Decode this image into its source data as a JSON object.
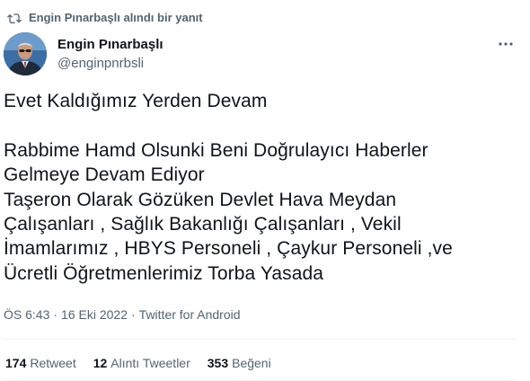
{
  "social_context": {
    "icon": "retweet-icon",
    "text": "Engin Pınarbaşlı alındı bir yanıt"
  },
  "author": {
    "display_name": "Engin Pınarbaşlı",
    "handle": "@enginpnrbsli",
    "avatar": "profile-photo"
  },
  "more_icon": "more-horizontal-icon",
  "tweet": {
    "lines": [
      "Evet Kaldığımız Yerden Devam",
      "",
      "Rabbime Hamd Olsunki Beni Doğrulayıcı Haberler",
      "Gelmeye Devam Ediyor",
      "Taşeron Olarak Gözüken Devlet Hava Meydan",
      "Çalışanları , Sağlık Bakanlığı Çalışanları , Vekil",
      "İmamlarımız , HBYS Personeli , Çaykur Personeli ,ve",
      "Ücretli Öğretmenlerimiz Torba Yasada"
    ]
  },
  "meta": {
    "time": "ÖS 6:43",
    "separator1": "·",
    "date": "16 Eki 2022",
    "separator2": "·",
    "source": "Twitter for Android"
  },
  "stats": {
    "retweets_count": "174",
    "retweets_label": "Retweet",
    "quotes_count": "12",
    "quotes_label": "Alıntı Tweetler",
    "likes_count": "353",
    "likes_label": "Beğeni"
  },
  "colors": {
    "text_primary": "#0f1419",
    "text_secondary": "#536471",
    "divider": "#eff3f4"
  }
}
